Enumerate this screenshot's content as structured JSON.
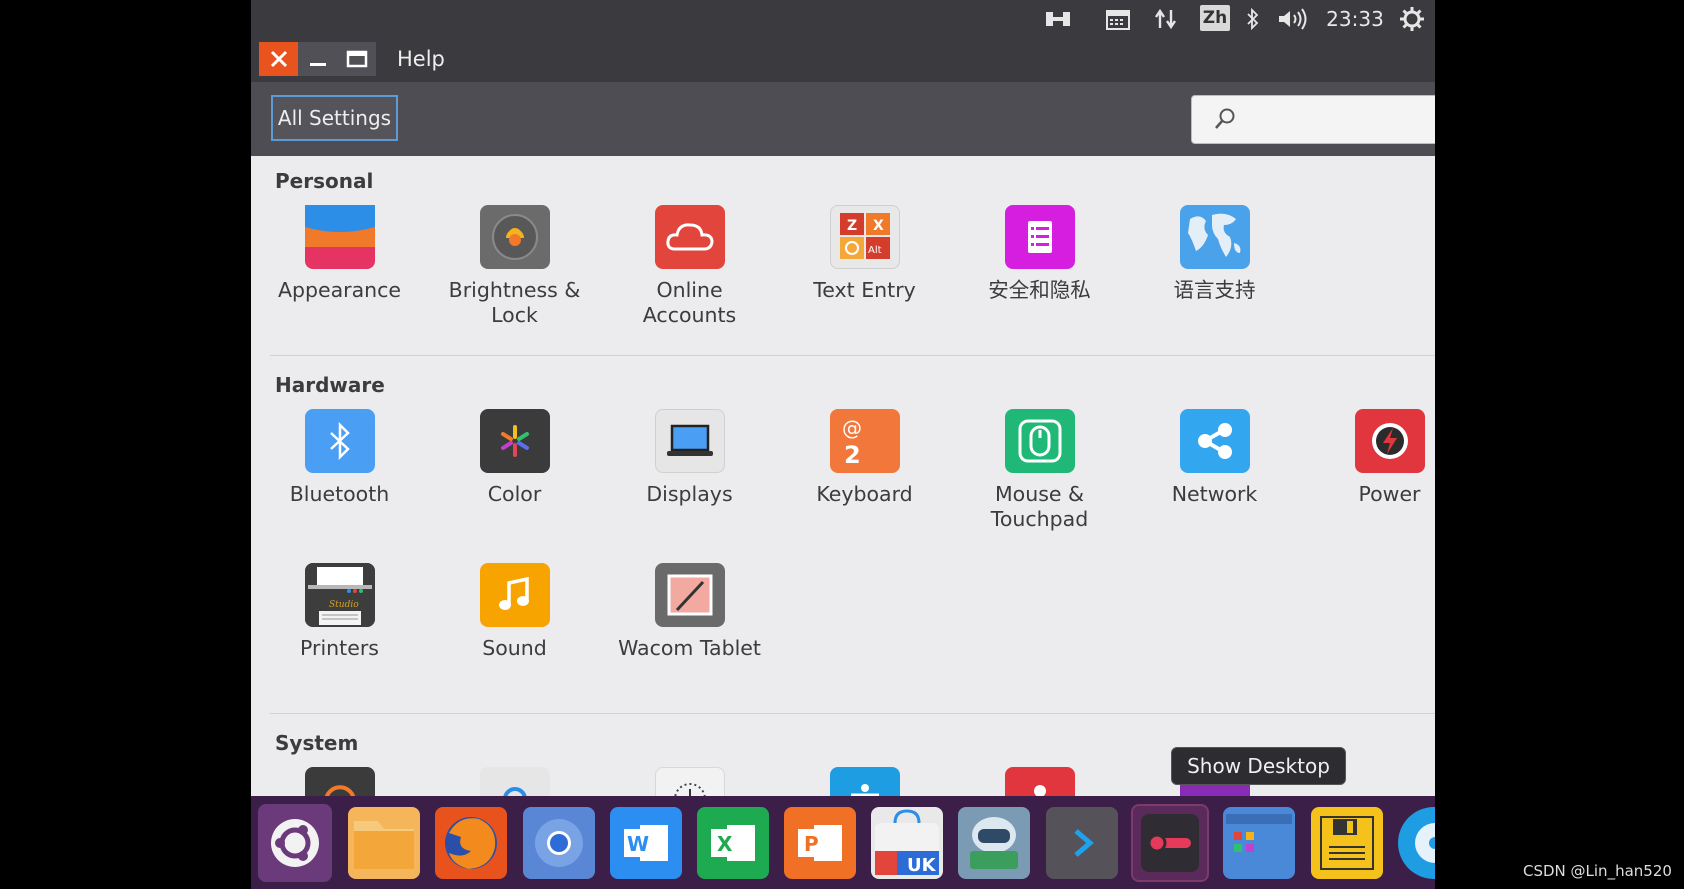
{
  "top_panel": {
    "indicators": [
      "network-transfer-icon",
      "calendar-icon",
      "updown-arrows-icon",
      "bluetooth-icon",
      "volume-icon",
      "power-gear-icon"
    ],
    "input_method": "Zh",
    "clock": "23:33"
  },
  "window": {
    "controls": [
      "close-icon",
      "minimize-icon",
      "maximize-icon"
    ],
    "menu": {
      "help": "Help"
    }
  },
  "toolbar": {
    "all_settings": "All Settings",
    "search_placeholder": ""
  },
  "sections": {
    "personal": {
      "title": "Personal",
      "items": [
        {
          "label": "Appearance",
          "icon": "appearance-icon",
          "color": "#f39c12"
        },
        {
          "label": "Brightness &\nLock",
          "icon": "brightness-lock-icon",
          "color": "#6b6b6b"
        },
        {
          "label": "Online\nAccounts",
          "icon": "online-accounts-icon",
          "color": "#e2453c"
        },
        {
          "label": "Text Entry",
          "icon": "text-entry-icon",
          "color": "#e8e8e8"
        },
        {
          "label": "安全和隐私",
          "icon": "security-privacy-icon",
          "color": "#d61ee0"
        },
        {
          "label": "语言支持",
          "icon": "language-support-icon",
          "color": "#4aa3ea"
        }
      ]
    },
    "hardware": {
      "title": "Hardware",
      "items": [
        {
          "label": "Bluetooth",
          "icon": "bluetooth-icon",
          "color": "#4a9ff5"
        },
        {
          "label": "Color",
          "icon": "color-icon",
          "color": "#3b3b3b"
        },
        {
          "label": "Displays",
          "icon": "displays-icon",
          "color": "#e6e6e6"
        },
        {
          "label": "Keyboard",
          "icon": "keyboard-icon",
          "color": "#f2773a"
        },
        {
          "label": "Mouse &\nTouchpad",
          "icon": "mouse-touchpad-icon",
          "color": "#1fb877"
        },
        {
          "label": "Network",
          "icon": "network-icon",
          "color": "#33a6f0"
        },
        {
          "label": "Power",
          "icon": "power-icon",
          "color": "#e2363f"
        },
        {
          "label": "Printers",
          "icon": "printer-icon",
          "color": "#3d3d3d"
        },
        {
          "label": "Sound",
          "icon": "sound-icon",
          "color": "#f7a300"
        },
        {
          "label": "Wacom Tablet",
          "icon": "wacom-tablet-icon",
          "color": "#6a6a6a"
        }
      ]
    },
    "system": {
      "title": "System"
    }
  },
  "launcher": {
    "items": [
      {
        "name": "ubuntu-dash-icon",
        "color": "#6b3a7a"
      },
      {
        "name": "files-icon",
        "color": "#f5b55a"
      },
      {
        "name": "firefox-icon",
        "color": "#e8531d"
      },
      {
        "name": "chromium-icon",
        "color": "#5a86d6"
      },
      {
        "name": "word-icon",
        "color": "#2b8ef0"
      },
      {
        "name": "excel-icon",
        "color": "#1eaa50"
      },
      {
        "name": "powerpoint-icon",
        "color": "#f07026"
      },
      {
        "name": "software-center-icon",
        "color": "#e9e9e9"
      },
      {
        "name": "screenshot-robot-icon",
        "color": "#7b9bb5"
      },
      {
        "name": "terminal-arrow-icon",
        "color": "#555359"
      },
      {
        "name": "toggle-app-icon",
        "color": "#2f2c33"
      },
      {
        "name": "workspaces-icon",
        "color": "#4a88d8"
      },
      {
        "name": "save-disk-icon",
        "color": "#f4c21a"
      },
      {
        "name": "dvd-icon",
        "color": "#1f9de3"
      }
    ],
    "tooltip": "Show Desktop"
  },
  "watermark": "CSDN @Lin_han520"
}
